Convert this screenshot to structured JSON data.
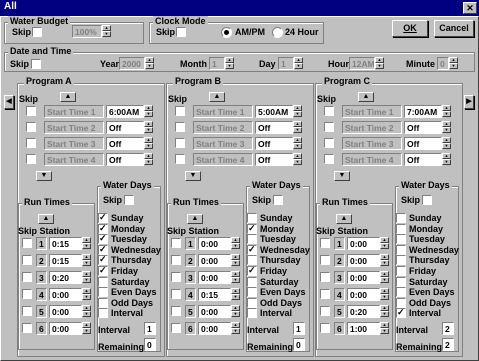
{
  "window": {
    "title": "All",
    "close": "✕"
  },
  "buttons": {
    "ok": "OK",
    "cancel": "Cancel",
    "left": "◀",
    "right": "▶",
    "up": "▲",
    "down": "▼"
  },
  "water_budget": {
    "legend": "Water Budget",
    "skip": "Skip",
    "value": "100%"
  },
  "clock_mode": {
    "legend": "Clock Mode",
    "skip": "Skip",
    "ampm": "AM/PM",
    "h24": "24 Hour"
  },
  "date_time": {
    "legend": "Date and Time",
    "skip": "Skip",
    "year_label": "Year",
    "year": "2000",
    "month_label": "Month",
    "month": "1",
    "day_label": "Day",
    "day": "1",
    "hour_label": "Hour",
    "hour": "12AM",
    "minute_label": "Minute",
    "minute": "0"
  },
  "labels": {
    "skip": "Skip",
    "start_time": "Start Time",
    "run_times": "Run Times",
    "skip_station": "Skip Station",
    "water_days": "Water Days",
    "interval": "Interval",
    "remaining": "Remaining"
  },
  "days": [
    "Sunday",
    "Monday",
    "Tuesday",
    "Wednesday",
    "Thursday",
    "Friday",
    "Saturday",
    "Even Days",
    "Odd Days",
    "Interval"
  ],
  "programs": [
    {
      "name": "Program A",
      "start": [
        "6:00AM",
        "Off",
        "Off",
        "Off"
      ],
      "runs": [
        "0:15",
        "0:15",
        "0:20",
        "0:00",
        "0:00",
        "0:00"
      ],
      "days": [
        true,
        true,
        true,
        true,
        true,
        true,
        false,
        false,
        false,
        false
      ],
      "interval": "1",
      "remaining": "0"
    },
    {
      "name": "Program B",
      "start": [
        "5:00AM",
        "Off",
        "Off",
        "Off"
      ],
      "runs": [
        "0:00",
        "0:00",
        "0:00",
        "0:15",
        "0:00",
        "0:00"
      ],
      "days": [
        false,
        true,
        false,
        true,
        false,
        true,
        false,
        false,
        false,
        false
      ],
      "interval": "1",
      "remaining": "0"
    },
    {
      "name": "Program C",
      "start": [
        "7:00AM",
        "Off",
        "Off",
        "Off"
      ],
      "runs": [
        "0:00",
        "0:00",
        "0:00",
        "0:00",
        "0:20",
        "1:00"
      ],
      "days": [
        false,
        false,
        false,
        false,
        false,
        false,
        false,
        false,
        false,
        true
      ],
      "interval": "2",
      "remaining": "2"
    }
  ]
}
